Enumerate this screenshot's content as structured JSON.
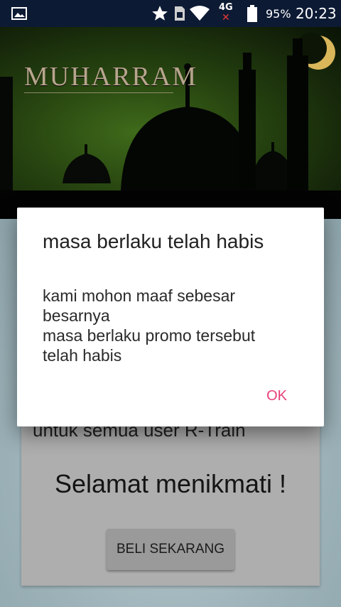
{
  "status_bar": {
    "network": "4G",
    "battery": "95%",
    "time": "20:23",
    "icons": [
      "gallery-icon",
      "star-icon",
      "sim-card-icon",
      "wifi-icon",
      "signal-icon",
      "battery-icon"
    ]
  },
  "banner": {
    "title": "MUHARRAM"
  },
  "card": {
    "line": "untuk semua user R-Train",
    "enjoy": "Selamat menikmati !",
    "buy_button": "BELI SEKARANG"
  },
  "dialog": {
    "title": "masa berlaku telah habis",
    "message_lines": [
      "kami mohon maaf sebesar",
      "besarnya",
      "masa berlaku promo tersebut",
      "telah habis"
    ],
    "ok_button": "OK"
  },
  "colors": {
    "status_bar": "#0d1a34",
    "dialog_accent": "#e8407a",
    "card": "#aeaeae"
  }
}
